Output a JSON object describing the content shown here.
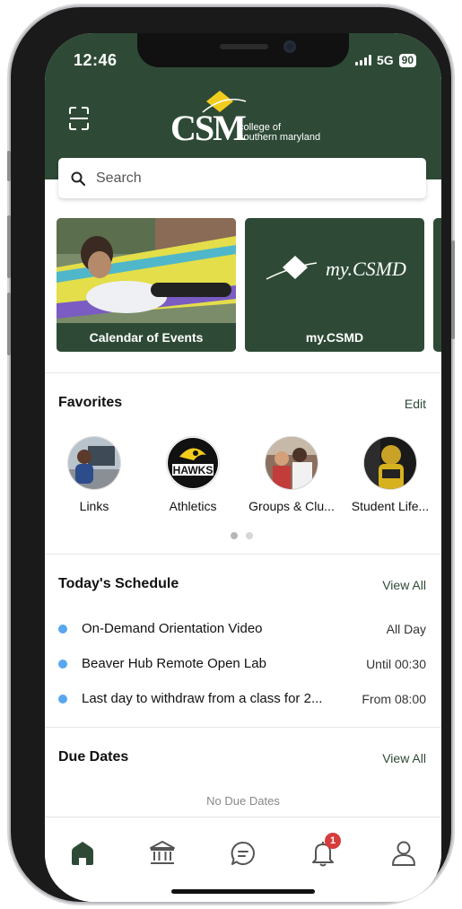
{
  "status_bar": {
    "time": "12:46",
    "network": "5G",
    "battery": "90"
  },
  "header": {
    "logo_text": "CSM",
    "logo_subtitle_line1": "college of",
    "logo_subtitle_line2": "southern maryland"
  },
  "search": {
    "placeholder": "Search"
  },
  "cards": [
    {
      "label": "Calendar of Events"
    },
    {
      "label": "my.CSMD",
      "logo_text": "my.CSMD"
    }
  ],
  "favorites": {
    "title": "Favorites",
    "edit_label": "Edit",
    "items": [
      {
        "label": "Links"
      },
      {
        "label": "Athletics"
      },
      {
        "label": "Groups & Clu..."
      },
      {
        "label": "Student Life..."
      }
    ],
    "page_indicator": {
      "current": 1,
      "total": 2
    }
  },
  "schedule": {
    "title": "Today's Schedule",
    "view_all_label": "View All",
    "events": [
      {
        "name": "On-Demand Orientation Video",
        "when": "All Day"
      },
      {
        "name": "Beaver Hub Remote Open Lab",
        "when": "Until 00:30"
      },
      {
        "name": "Last day to withdraw from a class for 2...",
        "when": "From 08:00"
      }
    ]
  },
  "due_dates": {
    "title": "Due Dates",
    "view_all_label": "View All",
    "empty_text": "No Due Dates"
  },
  "tab_bar": {
    "items": [
      "home-icon",
      "institution-icon",
      "chat-icon",
      "bell-icon",
      "profile-icon"
    ],
    "notification_count": "1"
  },
  "colors": {
    "brand_green": "#2e4a36",
    "accent_yellow": "#f2cc1c",
    "event_dot": "#58a6ef",
    "badge_red": "#d63c3c"
  }
}
